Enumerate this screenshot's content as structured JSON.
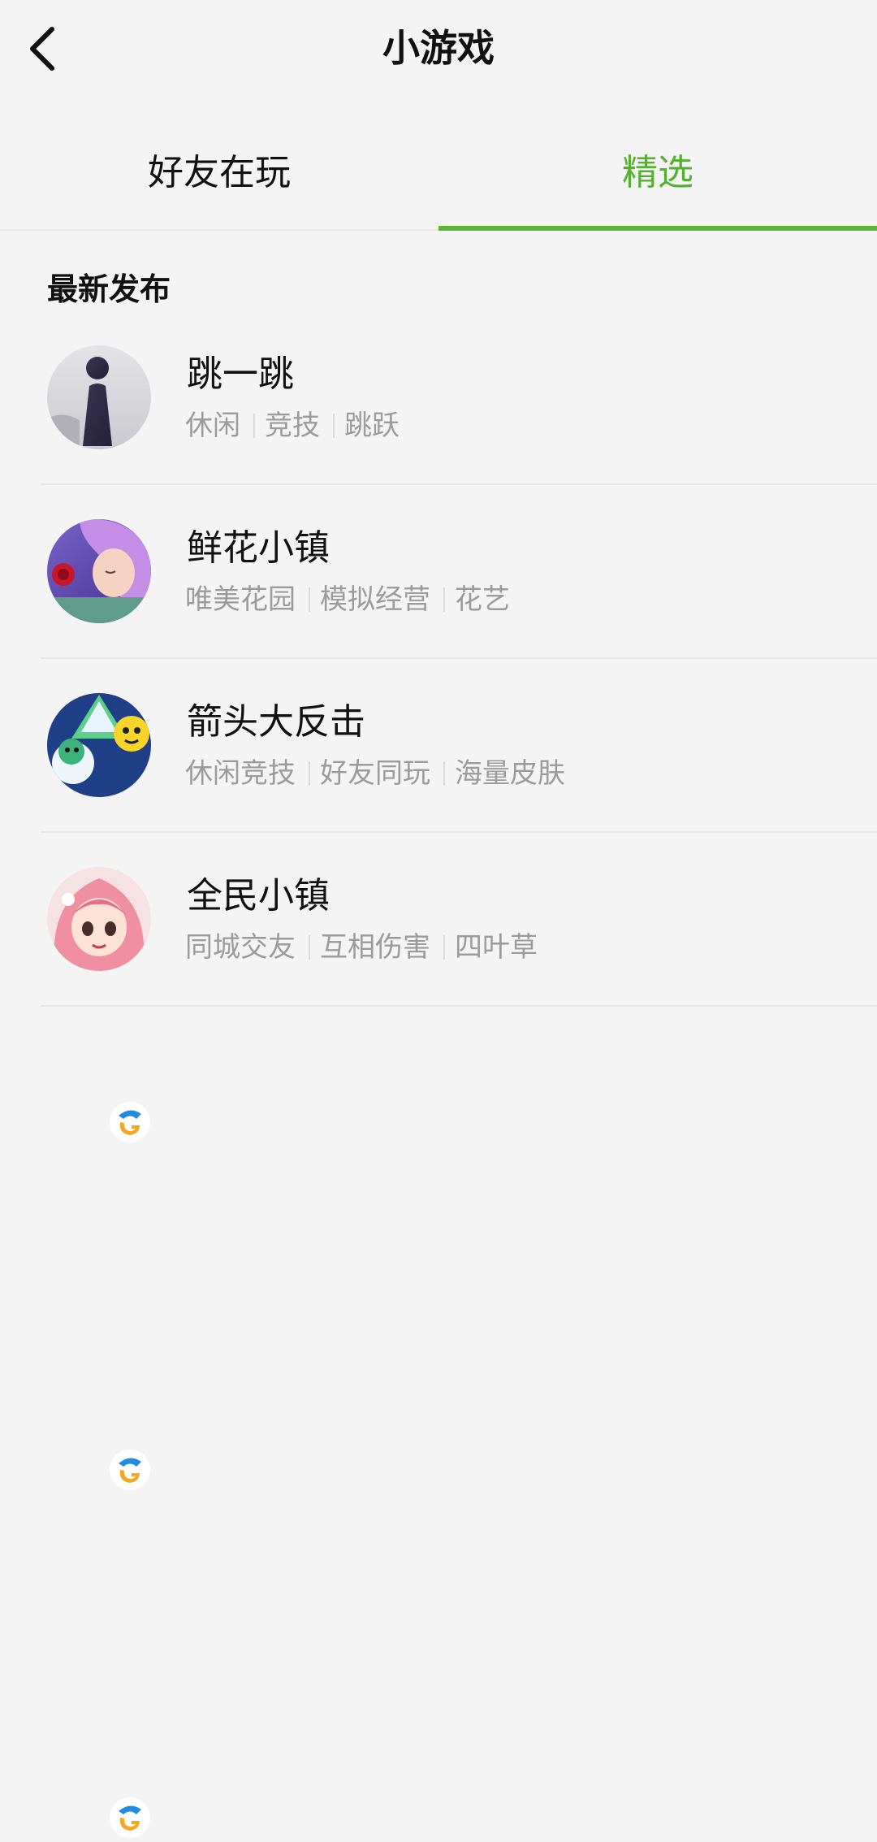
{
  "nav": {
    "title": "小游戏",
    "back_icon": "chevron-left-icon"
  },
  "tabs": [
    {
      "label": "好友在玩",
      "active": false
    },
    {
      "label": "精选",
      "active": true
    }
  ],
  "colors": {
    "accent": "#57b634",
    "tag_text": "#9b9b9b",
    "background": "#f4f4f4"
  },
  "section": {
    "title": "最新发布"
  },
  "games": [
    {
      "name": "跳一跳",
      "tags": [
        "休闲",
        "竞技",
        "跳跃"
      ],
      "icon": "jump-game-icon"
    },
    {
      "name": "鲜花小镇",
      "tags": [
        "唯美花园",
        "模拟经营",
        "花艺"
      ],
      "icon": "flower-town-icon"
    },
    {
      "name": "箭头大反击",
      "tags": [
        "休闲竞技",
        "好友同玩",
        "海量皮肤"
      ],
      "icon": "arrow-strike-icon"
    },
    {
      "name": "全民小镇",
      "tags": [
        "同城交友",
        "互相伤害",
        "四叶草"
      ],
      "icon": "town-girl-icon"
    }
  ]
}
